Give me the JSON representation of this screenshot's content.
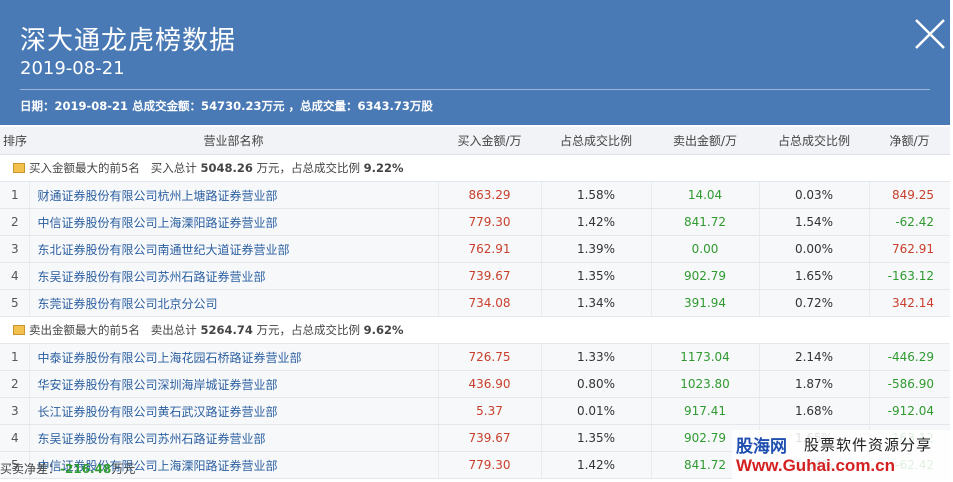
{
  "header": {
    "title": "深大通龙虎榜数据",
    "date": "2019-08-21",
    "summary": "日期：2019-08-21 总成交金额：54730.23万元 ，总成交量：6343.73万股"
  },
  "columns": [
    "排序",
    "营业部名称",
    "买入金额/万",
    "占总成交比例",
    "卖出金额/万",
    "占总成交比例",
    "净额/万"
  ],
  "buy_section": {
    "label": "买入金额最大的前5名",
    "total_prefix": "买入总计",
    "total_value": "5048.26",
    "total_suffix": "万元，占总成交比例",
    "ratio": "9.22%",
    "rows": [
      {
        "rank": "1",
        "name": "财通证券股份有限公司杭州上塘路证券营业部",
        "buy": "863.29",
        "buy_pct": "1.58%",
        "sell": "14.04",
        "sell_pct": "0.03%",
        "net": "849.25"
      },
      {
        "rank": "2",
        "name": "中信证券股份有限公司上海溧阳路证券营业部",
        "buy": "779.30",
        "buy_pct": "1.42%",
        "sell": "841.72",
        "sell_pct": "1.54%",
        "net": "-62.42"
      },
      {
        "rank": "3",
        "name": "东北证券股份有限公司南通世纪大道证券营业部",
        "buy": "762.91",
        "buy_pct": "1.39%",
        "sell": "0.00",
        "sell_pct": "0.00%",
        "net": "762.91"
      },
      {
        "rank": "4",
        "name": "东吴证券股份有限公司苏州石路证券营业部",
        "buy": "739.67",
        "buy_pct": "1.35%",
        "sell": "902.79",
        "sell_pct": "1.65%",
        "net": "-163.12"
      },
      {
        "rank": "5",
        "name": "东莞证券股份有限公司北京分公司",
        "buy": "734.08",
        "buy_pct": "1.34%",
        "sell": "391.94",
        "sell_pct": "0.72%",
        "net": "342.14"
      }
    ]
  },
  "sell_section": {
    "label": "卖出金额最大的前5名",
    "total_prefix": "卖出总计",
    "total_value": "5264.74",
    "total_suffix": "万元，占总成交比例",
    "ratio": "9.62%",
    "rows": [
      {
        "rank": "1",
        "name": "中泰证券股份有限公司上海花园石桥路证券营业部",
        "buy": "726.75",
        "buy_pct": "1.33%",
        "sell": "1173.04",
        "sell_pct": "2.14%",
        "net": "-446.29"
      },
      {
        "rank": "2",
        "name": "华安证券股份有限公司深圳海岸城证券营业部",
        "buy": "436.90",
        "buy_pct": "0.80%",
        "sell": "1023.80",
        "sell_pct": "1.87%",
        "net": "-586.90"
      },
      {
        "rank": "3",
        "name": "长江证券股份有限公司黄石武汉路证券营业部",
        "buy": "5.37",
        "buy_pct": "0.01%",
        "sell": "917.41",
        "sell_pct": "1.68%",
        "net": "-912.04"
      },
      {
        "rank": "4",
        "name": "东吴证券股份有限公司苏州石路证券营业部",
        "buy": "739.67",
        "buy_pct": "1.35%",
        "sell": "902.79",
        "sell_pct": "1.65%",
        "net": "-163.12"
      },
      {
        "rank": "5",
        "name": "中信证券股份有限公司上海溧阳路证券营业部",
        "buy": "779.30",
        "buy_pct": "1.42%",
        "sell": "841.72",
        "sell_pct": "1.54%",
        "net": "-62.42"
      }
    ]
  },
  "net": {
    "label": "买卖净差：",
    "value": "-216.48",
    "unit": "万元"
  },
  "watermark": {
    "line1": "股海网",
    "line2": "股票软件资源分享",
    "line3": "Www.Guhai.com.cn"
  },
  "colors": {
    "header_bg": "#4a7ab5",
    "buy_amount": "#c8402c",
    "sell_amount": "#2f9a2f",
    "link": "#2b5fa0"
  }
}
